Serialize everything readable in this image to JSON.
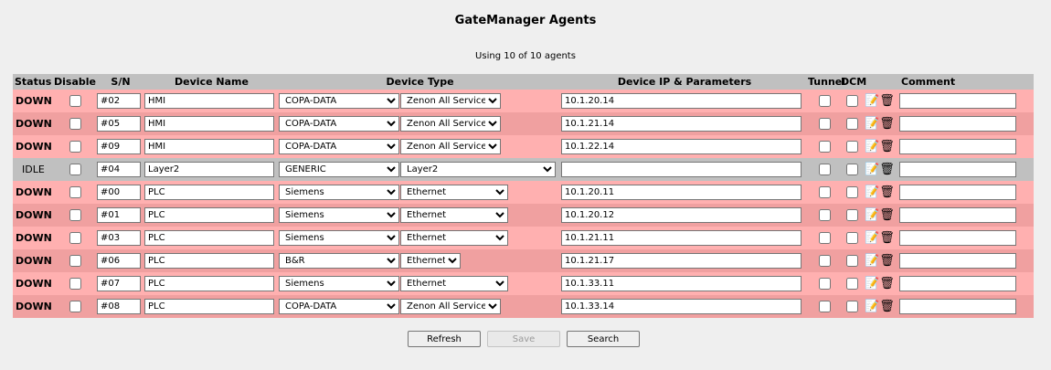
{
  "title": "GateManager Agents",
  "usage": "Using 10 of 10 agents",
  "headers": {
    "status": "Status",
    "disable": "Disable",
    "sn": "S/N",
    "device_name": "Device Name",
    "device_type": "Device Type",
    "device_ip": "Device IP & Parameters",
    "tunnel": "Tunnel",
    "dcm": "DCM",
    "comment": "Comment"
  },
  "rows": [
    {
      "status": "DOWN",
      "sn": "#02",
      "name": "HMI",
      "vendor": "COPA-DATA",
      "type": "Zenon All Service",
      "ip": "10.1.20.14",
      "comment": ""
    },
    {
      "status": "DOWN",
      "sn": "#05",
      "name": "HMI",
      "vendor": "COPA-DATA",
      "type": "Zenon All Service",
      "ip": "10.1.21.14",
      "comment": ""
    },
    {
      "status": "DOWN",
      "sn": "#09",
      "name": "HMI",
      "vendor": "COPA-DATA",
      "type": "Zenon All Service",
      "ip": "10.1.22.14",
      "comment": ""
    },
    {
      "status": "IDLE",
      "sn": "#04",
      "name": "Layer2",
      "vendor": "GENERIC",
      "type": "Layer2",
      "ip": "",
      "comment": ""
    },
    {
      "status": "DOWN",
      "sn": "#00",
      "name": "PLC",
      "vendor": "Siemens",
      "type": "Ethernet",
      "ip": "10.1.20.11",
      "comment": ""
    },
    {
      "status": "DOWN",
      "sn": "#01",
      "name": "PLC",
      "vendor": "Siemens",
      "type": "Ethernet",
      "ip": "10.1.20.12",
      "comment": ""
    },
    {
      "status": "DOWN",
      "sn": "#03",
      "name": "PLC",
      "vendor": "Siemens",
      "type": "Ethernet",
      "ip": "10.1.21.11",
      "comment": ""
    },
    {
      "status": "DOWN",
      "sn": "#06",
      "name": "PLC",
      "vendor": "B&R",
      "type": "Ethernet",
      "ip": "10.1.21.17",
      "comment": ""
    },
    {
      "status": "DOWN",
      "sn": "#07",
      "name": "PLC",
      "vendor": "Siemens",
      "type": "Ethernet",
      "ip": "10.1.33.11",
      "comment": ""
    },
    {
      "status": "DOWN",
      "sn": "#08",
      "name": "PLC",
      "vendor": "COPA-DATA",
      "type": "Zenon All Service",
      "ip": "10.1.33.14",
      "comment": ""
    }
  ],
  "row_icons": [
    "edit-icon",
    "trash-icon"
  ],
  "buttons": {
    "refresh": "Refresh",
    "save": "Save",
    "search": "Search"
  },
  "colors": {
    "down_row": "#ffb0b0",
    "idle_row": "#c0c0c0",
    "header": "#c0c0c0"
  }
}
